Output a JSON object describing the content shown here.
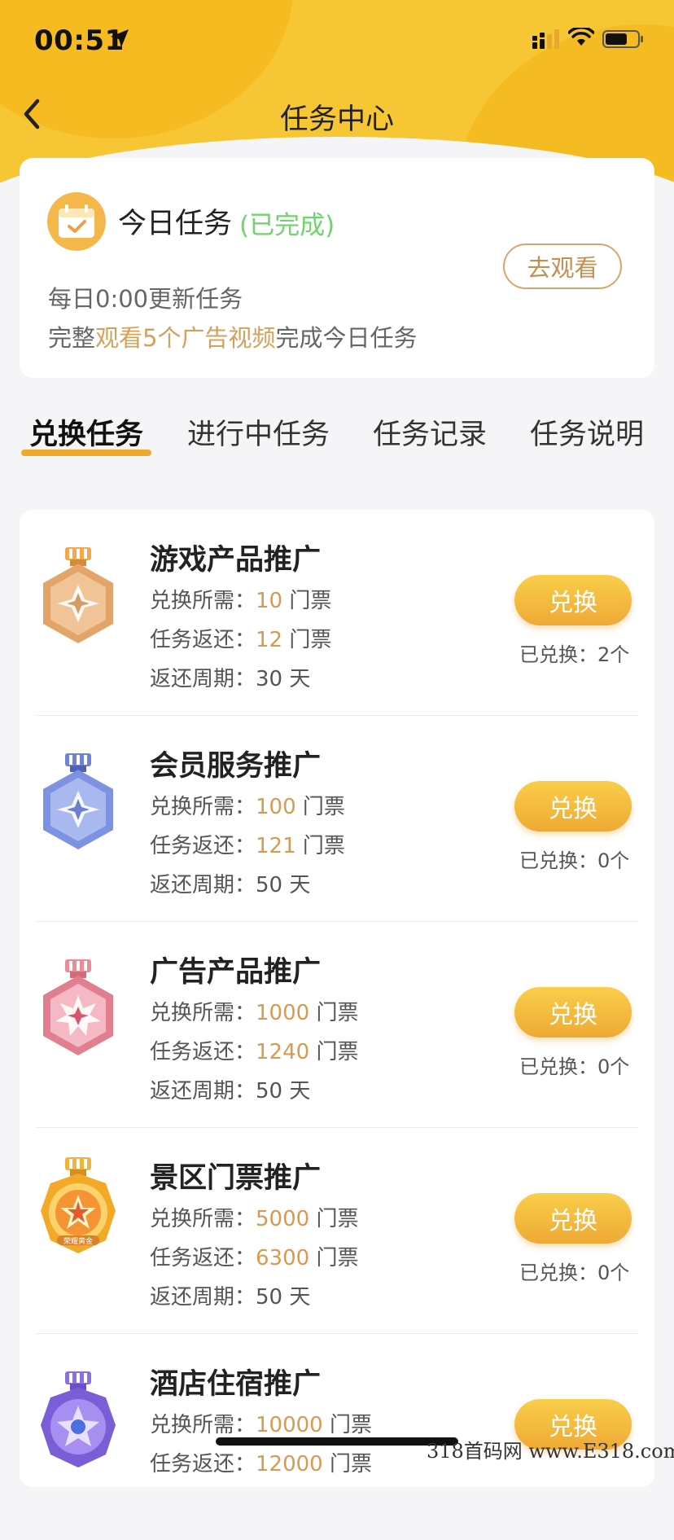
{
  "status_bar": {
    "time": "00:51"
  },
  "nav": {
    "title": "任务中心"
  },
  "today": {
    "title": "今日任务",
    "status": "(已完成)",
    "watch_button": "去观看",
    "line1": "每日0:00更新任务",
    "line2_prefix": "完整",
    "line2_highlight": "观看5个广告视频",
    "line2_suffix": "完成今日任务"
  },
  "tabs": [
    {
      "label": "兑换任务",
      "active": true
    },
    {
      "label": "进行中任务",
      "active": false
    },
    {
      "label": "任务记录",
      "active": false
    },
    {
      "label": "任务说明",
      "active": false
    }
  ],
  "labels": {
    "cost": "兑换所需：",
    "return": "任务返还：",
    "period": "返还周期：",
    "ticket_unit": "门票",
    "day_unit": "天",
    "exchange_button": "兑换",
    "exchanged": "已兑换："
  },
  "tasks": [
    {
      "title": "游戏产品推广",
      "cost": "10",
      "return": "12",
      "period": "30",
      "exchanged": "2个",
      "medal": "bronze-medal-icon"
    },
    {
      "title": "会员服务推广",
      "cost": "100",
      "return": "121",
      "period": "50",
      "exchanged": "0个",
      "medal": "blue-medal-icon"
    },
    {
      "title": "广告产品推广",
      "cost": "1000",
      "return": "1240",
      "period": "50",
      "exchanged": "0个",
      "medal": "pink-medal-icon"
    },
    {
      "title": "景区门票推广",
      "cost": "5000",
      "return": "6300",
      "period": "50",
      "exchanged": "0个",
      "medal": "gold-medal-icon",
      "medal_text": "荣耀黄金"
    },
    {
      "title": "酒店住宿推广",
      "cost": "10000",
      "return": "12000",
      "period": "",
      "exchanged": "",
      "medal": "purple-medal-icon"
    }
  ],
  "watermark": "318首码网 www.E318.com",
  "colors": {
    "header_yellow": "#f7c634",
    "accent_gold": "#d79a50",
    "completed_green": "#6ed46b",
    "button_gradient_top": "#f9ce4a",
    "button_gradient_bottom": "#efa935",
    "tab_underline": "#f0a82c"
  }
}
